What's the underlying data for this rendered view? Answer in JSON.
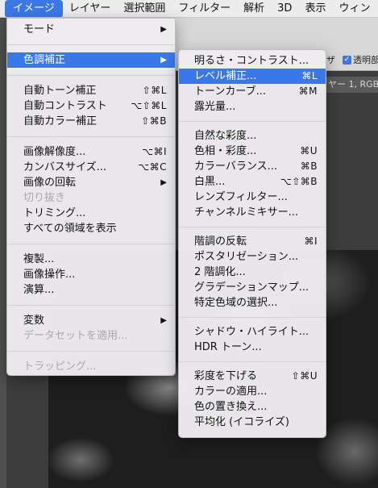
{
  "menubar": {
    "items": [
      "イメージ",
      "レイヤー",
      "選択範囲",
      "フィルター",
      "解析",
      "3D",
      "表示",
      "ウィン"
    ]
  },
  "background": {
    "options_text": "ザ",
    "transparent_checkbox_label": "透明部",
    "checkbox_mark": "✓",
    "doc_tab_text": "ヤー 1, RGB"
  },
  "image_menu": {
    "items": [
      {
        "label": "モード",
        "shortcut": "▶",
        "disabled": false
      },
      {
        "label": "色調補正",
        "shortcut": "▶",
        "disabled": false,
        "highlight": true
      },
      {
        "label": "自動トーン補正",
        "shortcut": "⇧⌘L",
        "disabled": false
      },
      {
        "label": "自動コントラスト",
        "shortcut": "⌥⇧⌘L",
        "disabled": false
      },
      {
        "label": "自動カラー補正",
        "shortcut": "⇧⌘B",
        "disabled": false
      },
      {
        "label": "画像解像度...",
        "shortcut": "⌥⌘I",
        "disabled": false
      },
      {
        "label": "カンバスサイズ...",
        "shortcut": "⌥⌘C",
        "disabled": false
      },
      {
        "label": "画像の回転",
        "shortcut": "▶",
        "disabled": false
      },
      {
        "label": "切り抜き",
        "shortcut": "",
        "disabled": true
      },
      {
        "label": "トリミング...",
        "shortcut": "",
        "disabled": false
      },
      {
        "label": "すべての領域を表示",
        "shortcut": "",
        "disabled": false
      },
      {
        "label": "複製...",
        "shortcut": "",
        "disabled": false
      },
      {
        "label": "画像操作...",
        "shortcut": "",
        "disabled": false
      },
      {
        "label": "演算...",
        "shortcut": "",
        "disabled": false
      },
      {
        "label": "変数",
        "shortcut": "▶",
        "disabled": false
      },
      {
        "label": "データセットを適用...",
        "shortcut": "",
        "disabled": true
      },
      {
        "label": "トラッピング...",
        "shortcut": "",
        "disabled": true
      }
    ]
  },
  "adjustments_menu": {
    "items": [
      {
        "label": "明るさ・コントラスト...",
        "shortcut": ""
      },
      {
        "label": "レベル補正...",
        "shortcut": "⌘L",
        "highlight": true
      },
      {
        "label": "トーンカーブ...",
        "shortcut": "⌘M"
      },
      {
        "label": "露光量...",
        "shortcut": ""
      },
      {
        "label": "自然な彩度...",
        "shortcut": ""
      },
      {
        "label": "色相・彩度...",
        "shortcut": "⌘U"
      },
      {
        "label": "カラーバランス...",
        "shortcut": "⌘B"
      },
      {
        "label": "白黒...",
        "shortcut": "⌥⇧⌘B"
      },
      {
        "label": "レンズフィルター...",
        "shortcut": ""
      },
      {
        "label": "チャンネルミキサー...",
        "shortcut": ""
      },
      {
        "label": "階調の反転",
        "shortcut": "⌘I"
      },
      {
        "label": "ポスタリゼーション...",
        "shortcut": ""
      },
      {
        "label": "2 階調化...",
        "shortcut": ""
      },
      {
        "label": "グラデーションマップ...",
        "shortcut": ""
      },
      {
        "label": "特定色域の選択...",
        "shortcut": ""
      },
      {
        "label": "シャドウ・ハイライト...",
        "shortcut": ""
      },
      {
        "label": "HDR トーン...",
        "shortcut": ""
      },
      {
        "label": "彩度を下げる",
        "shortcut": "⇧⌘U"
      },
      {
        "label": "カラーの適用...",
        "shortcut": ""
      },
      {
        "label": "色の置き換え...",
        "shortcut": ""
      },
      {
        "label": "平均化 (イコライズ)",
        "shortcut": ""
      }
    ]
  },
  "colors": {
    "accent": "#3b78e7",
    "menu_bg": "#eeecf0",
    "disabled_text": "#a9a9a9"
  }
}
